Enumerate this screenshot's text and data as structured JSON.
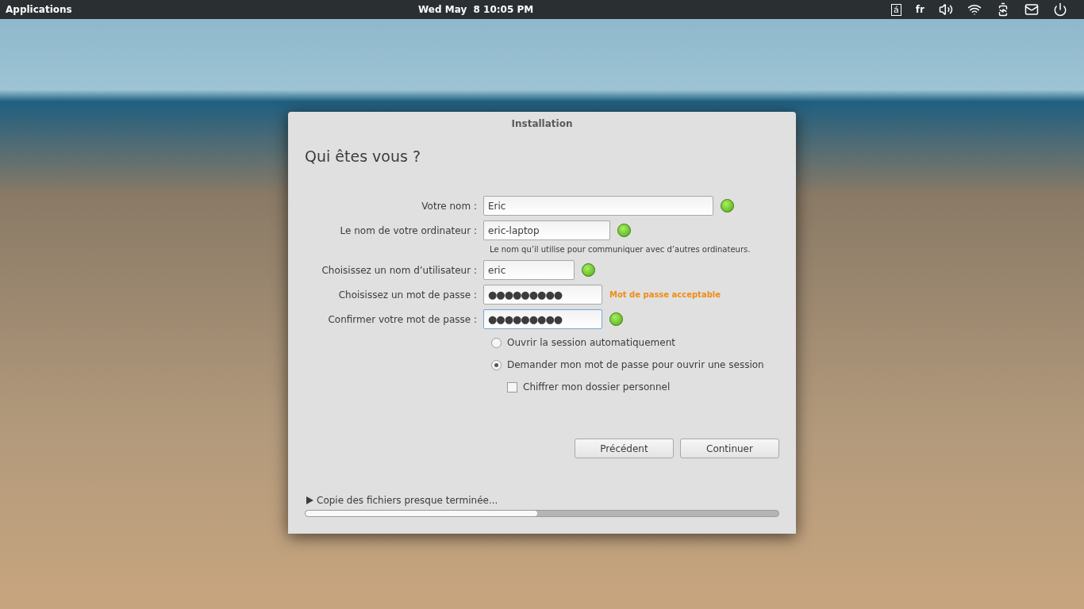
{
  "top_bar": {
    "menu": "Applications",
    "clock": "Wed May  8 10:05 PM",
    "keyboard_glyph": "á",
    "language": "fr"
  },
  "window": {
    "title": "Installation",
    "heading": "Qui êtes vous ?",
    "fields": [
      {
        "label": "Votre nom :",
        "value": "Eric",
        "kind": "text",
        "valid": true,
        "focused": false
      },
      {
        "label": "Le nom de votre ordinateur :",
        "value": "eric-laptop",
        "kind": "text",
        "valid": true,
        "focused": false,
        "hint": "Le nom qu’il utilise pour communiquer avec d’autres ordinateurs."
      },
      {
        "label": "Choisissez un nom d’utilisateur :",
        "value": "eric",
        "kind": "text",
        "valid": true,
        "focused": false
      },
      {
        "label": "Choisissez un mot de passe :",
        "value": "●●●●●●●●●",
        "kind": "password",
        "valid": false,
        "focused": false,
        "strength": "Mot de passe acceptable"
      },
      {
        "label": "Confirmer votre mot de passe :",
        "value": "●●●●●●●●●",
        "kind": "password",
        "valid": true,
        "focused": true
      }
    ],
    "login_options": [
      {
        "label": "Ouvrir la session automatiquement",
        "selected": false
      },
      {
        "label": "Demander mon mot de passe pour ouvrir une session",
        "selected": true
      }
    ],
    "encrypt": {
      "label": "Chiffrer mon dossier personnel",
      "checked": false
    },
    "buttons": [
      "Précédent",
      "Continuer"
    ],
    "progress": {
      "label": "Copie des fichiers presque terminée...",
      "expanded": false,
      "level": 0.49
    }
  }
}
